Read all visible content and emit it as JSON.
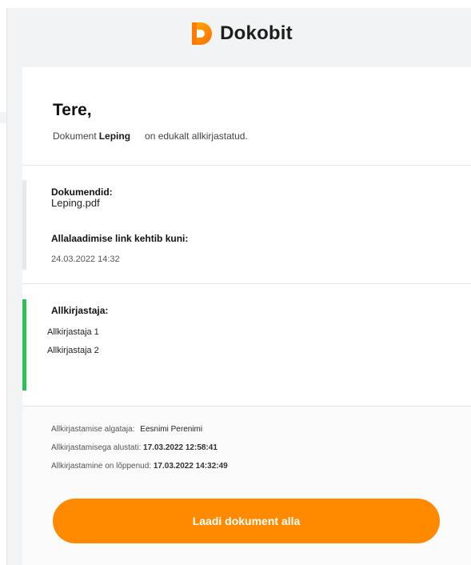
{
  "brand": {
    "name": "Dokobit",
    "logo_colors": [
      "#ff7a00",
      "#ffb000"
    ]
  },
  "message": {
    "greeting": "Tere,",
    "doc_prefix": "Dokument",
    "doc_name": "Leping",
    "doc_suffix": "on edukalt allkirjastatud."
  },
  "documents": {
    "label": "Dokumendid:",
    "file": "Leping.pdf",
    "link_label": "Allalaadimise link kehtib kuni:",
    "link_expiry": "24.03.2022 14:32"
  },
  "signers": {
    "label": "Allkirjastaja:",
    "items": [
      "Allkirjastaja 1",
      "Allkirjastaja 2"
    ]
  },
  "meta": {
    "initiator_label": "Allkirjastamise algataja:",
    "initiator_value": "Eesnimi Perenimi",
    "started_label": "Allkirjastamisega alustati:",
    "started_value": "17.03.2022 12:58:41",
    "finished_label": "Allkirjastamine on lõppenud:",
    "finished_value": "17.03.2022 14:32:49"
  },
  "download_button": {
    "label": "Laadi dokument alla",
    "color": "#ff8a00"
  },
  "colors": {
    "accent": "#ff8a00",
    "success": "#2bc155",
    "muted_bar": "#e6e7e8"
  }
}
